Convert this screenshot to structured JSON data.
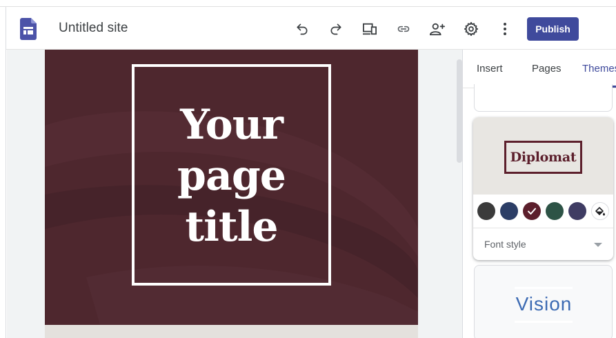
{
  "header": {
    "site_title": "Untitled site",
    "publish_label": "Publish",
    "icons": [
      "undo-icon",
      "redo-icon",
      "preview-devices-icon",
      "link-icon",
      "share-add-person-icon",
      "settings-gear-icon",
      "more-vertical-icon"
    ]
  },
  "canvas": {
    "hero_title": "Your page title"
  },
  "panel": {
    "tabs": [
      {
        "label": "Insert",
        "active": false
      },
      {
        "label": "Pages",
        "active": false
      },
      {
        "label": "Themes",
        "active": true
      }
    ],
    "themes": [
      {
        "name": "Diplomat",
        "selected_color": "#5c1f2c",
        "color_swatches": [
          "#3b3b3b",
          "#2c3e66",
          "#5c1f2c",
          "#2d5346",
          "#3f3c63"
        ],
        "font_style_label": "Font style"
      },
      {
        "name": "Vision"
      }
    ]
  },
  "colors": {
    "accent": "#3f4a9c",
    "hero_background": "#4e272e"
  }
}
